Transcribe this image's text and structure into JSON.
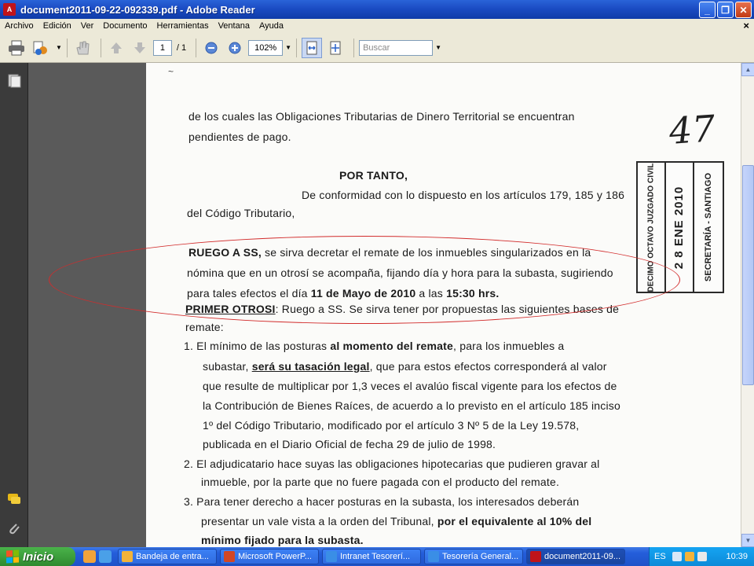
{
  "window": {
    "title": "document2011-09-22-092339.pdf - Adobe Reader",
    "app_icon_glyph": "A"
  },
  "menu": [
    "Archivo",
    "Edición",
    "Ver",
    "Documento",
    "Herramientas",
    "Ventana",
    "Ayuda"
  ],
  "toolbar": {
    "page_current": "1",
    "page_total": "/ 1",
    "zoom": "102%",
    "search_placeholder": "Buscar"
  },
  "document": {
    "line1": "de los cuales las Obligaciones Tributarias de Dinero Territorial se encuentran",
    "line2": "pendientes de pago.",
    "por_tanto": "POR TANTO,",
    "conformidad": "De conformidad con lo dispuesto en los artículos 179, 185 y 186",
    "codigo": "del Código Tributario,",
    "ruego_label": "RUEGO A SS,",
    "ruego_text": " se sirva decretar el remate de los inmuebles singularizados en la",
    "nomina": "nómina que en un otrosí se acompaña, fijando día y hora para la subasta, sugiriendo",
    "para_efectos": "para tales efectos el día ",
    "fecha": "11 de Mayo de 2010",
    "a_las": " a las ",
    "hora": "15:30 hrs.",
    "primer_otrosi": "PRIMER OTROSI",
    "primer_text": ": Ruego a SS. Se sirva tener por propuestas las siguientes bases de",
    "remate": "remate:",
    "item1_a": "1.  El mínimo de las posturas ",
    "item1_b": "al momento del remate",
    "item1_c": ", para los inmuebles a",
    "item1_l2a": "subastar, ",
    "item1_l2b": "será su tasación legal",
    "item1_l2c": ", que para estos efectos corresponderá al valor",
    "item1_l3": "que resulte de multiplicar por 1,3 veces el avalúo fiscal vigente para los efectos de",
    "item1_l4": "la Contribución de Bienes Raíces, de acuerdo a lo previsto en el artículo 185 inciso",
    "item1_l5": "1º del Código Tributario, modificado por el artículo 3 Nº 5 de la Ley 19.578,",
    "item1_l6": "publicada en el Diario Oficial de fecha 29 de julio de 1998.",
    "item2_l1": "2.  El adjudicatario hace suyas las obligaciones hipotecarias que pudieren gravar al",
    "item2_l2": "inmueble, por la parte que no fuere pagada con el producto del remate.",
    "item3_l1": "3.  Para tener derecho a hacer posturas en la subasta, los interesados deberán",
    "item3_l2a": "presentar un vale vista a la orden del Tribunal, ",
    "item3_l2b": "por el equivalente al 10% del",
    "item3_l3": "mínimo fijado para la subasta.",
    "handwritten_number": "47",
    "stamp_court": "DECIMO OCTAVO JUZGADO CIVIL",
    "stamp_date": "2 8 ENE 2010",
    "stamp_secretaria": "SECRETARÍA - SANTIAGO"
  },
  "taskbar": {
    "start_label": "Inicio",
    "tasks": [
      "Bandeja de entra...",
      "Microsoft PowerP...",
      "Intranet Tesorerí...",
      "Tesorería General...",
      "document2011-09..."
    ],
    "tray_lang": "ES",
    "clock": "10:39"
  }
}
